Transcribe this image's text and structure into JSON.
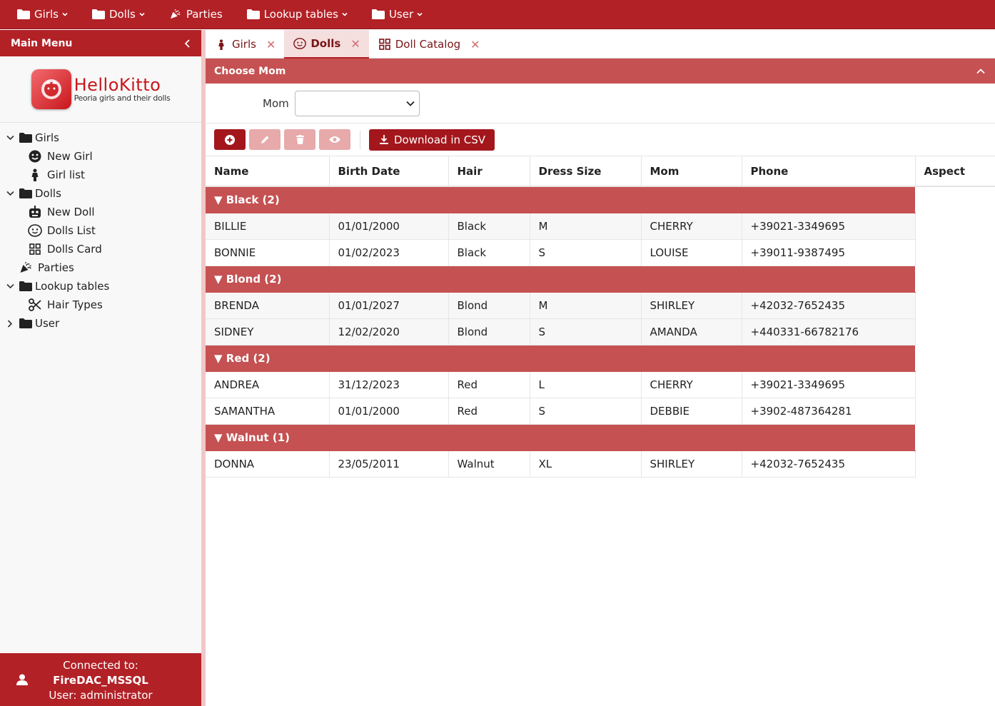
{
  "topbar": {
    "items": [
      {
        "label": "Girls",
        "icon": "folder-icon",
        "dropdown": true
      },
      {
        "label": "Dolls",
        "icon": "folder-icon",
        "dropdown": true
      },
      {
        "label": "Parties",
        "icon": "party-icon",
        "dropdown": false
      },
      {
        "label": "Lookup tables",
        "icon": "folder-icon",
        "dropdown": true
      },
      {
        "label": "User",
        "icon": "folder-icon",
        "dropdown": true
      }
    ]
  },
  "sidebar": {
    "title": "Main Menu",
    "logo": {
      "title": "HelloKitto",
      "subtitle": "Peoria girls and their dolls"
    },
    "tree": {
      "girls": {
        "label": "Girls",
        "children": [
          {
            "label": "New Girl",
            "icon": "smile-icon"
          },
          {
            "label": "Girl list",
            "icon": "girl-icon"
          }
        ]
      },
      "dolls": {
        "label": "Dolls",
        "children": [
          {
            "label": "New Doll",
            "icon": "robot-icon"
          },
          {
            "label": "Dolls List",
            "icon": "face-icon"
          },
          {
            "label": "Dolls Card",
            "icon": "grid-icon"
          }
        ]
      },
      "parties": {
        "label": "Parties",
        "icon": "party-icon"
      },
      "lookup": {
        "label": "Lookup tables",
        "children": [
          {
            "label": "Hair Types",
            "icon": "scissors-icon"
          }
        ]
      },
      "user": {
        "label": "User"
      }
    },
    "footer": {
      "line1": "Connected to:",
      "line2": "FireDAC_MSSQL",
      "line3": "User: administrator"
    }
  },
  "tabs": [
    {
      "label": "Girls",
      "icon": "girl-icon",
      "active": false
    },
    {
      "label": "Dolls",
      "icon": "face-icon",
      "active": true
    },
    {
      "label": "Doll Catalog",
      "icon": "grid-icon",
      "active": false
    }
  ],
  "panel": {
    "title": "Choose Mom"
  },
  "filter": {
    "label": "Mom",
    "value": ""
  },
  "toolbar": {
    "csv_label": "Download in CSV"
  },
  "grid": {
    "headers": [
      "Name",
      "Birth Date",
      "Hair",
      "Dress Size",
      "Mom",
      "Phone",
      "Aspect"
    ],
    "groups": [
      {
        "label": "Black (2)",
        "rows": [
          [
            "BILLIE",
            "01/01/2000",
            "Black",
            "M",
            "CHERRY",
            "+39021-3349695"
          ],
          [
            "BONNIE",
            "01/02/2023",
            "Black",
            "S",
            "LOUISE",
            "+39011-9387495"
          ]
        ]
      },
      {
        "label": "Blond (2)",
        "rows": [
          [
            "BRENDA",
            "01/01/2027",
            "Blond",
            "M",
            "SHIRLEY",
            "+42032-7652435"
          ],
          [
            "SIDNEY",
            "12/02/2020",
            "Blond",
            "S",
            "AMANDA",
            "+440331-66782176"
          ]
        ]
      },
      {
        "label": "Red (2)",
        "rows": [
          [
            "ANDREA",
            "31/12/2023",
            "Red",
            "L",
            "CHERRY",
            "+39021-3349695"
          ],
          [
            "SAMANTHA",
            "01/01/2000",
            "Red",
            "S",
            "DEBBIE",
            "+3902-487364281"
          ]
        ]
      },
      {
        "label": "Walnut (1)",
        "rows": [
          [
            "DONNA",
            "23/05/2011",
            "Walnut",
            "XL",
            "SHIRLEY",
            "+42032-7652435"
          ]
        ]
      }
    ]
  },
  "colors": {
    "primary": "#b22126",
    "group": "#c55152",
    "button": "#a3171c",
    "button_disabled": "#e7a9aa"
  }
}
